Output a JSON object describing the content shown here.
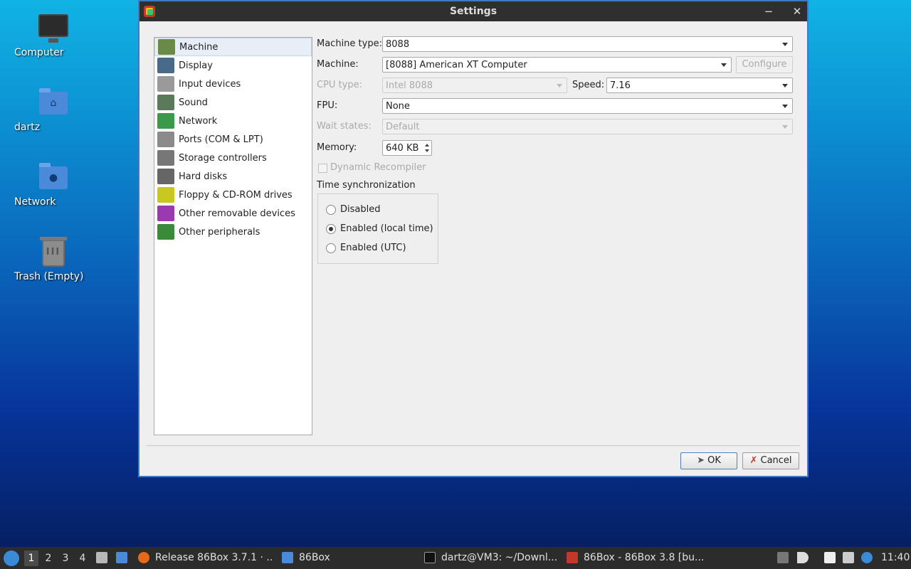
{
  "desktop": {
    "icons": [
      {
        "label": "Computer"
      },
      {
        "label": "dartz"
      },
      {
        "label": "Network"
      },
      {
        "label": "Trash (Empty)"
      }
    ]
  },
  "window": {
    "title": "Settings",
    "minimize_glyph": "−",
    "close_glyph": "✕"
  },
  "nav": {
    "items": [
      {
        "label": "Machine",
        "icon": "machine-icon"
      },
      {
        "label": "Display",
        "icon": "display-icon"
      },
      {
        "label": "Input devices",
        "icon": "input-devices-icon"
      },
      {
        "label": "Sound",
        "icon": "sound-icon"
      },
      {
        "label": "Network",
        "icon": "network-icon"
      },
      {
        "label": "Ports (COM & LPT)",
        "icon": "ports-icon"
      },
      {
        "label": "Storage controllers",
        "icon": "storage-icon"
      },
      {
        "label": "Hard disks",
        "icon": "hard-disk-icon"
      },
      {
        "label": "Floppy & CD-ROM drives",
        "icon": "floppy-cdrom-icon"
      },
      {
        "label": "Other removable devices",
        "icon": "removable-icon"
      },
      {
        "label": "Other peripherals",
        "icon": "peripherals-icon"
      }
    ],
    "selected": "Machine"
  },
  "form": {
    "machine_type": {
      "label": "Machine type:",
      "value": "8088"
    },
    "machine": {
      "label": "Machine:",
      "value": "[8088] American XT Computer",
      "configure": "Configure"
    },
    "cpu_type": {
      "label": "CPU type:",
      "value": "Intel 8088"
    },
    "speed": {
      "label": "Speed:",
      "value": "7.16"
    },
    "fpu": {
      "label": "FPU:",
      "value": "None"
    },
    "wait_states": {
      "label": "Wait states:",
      "value": "Default"
    },
    "memory": {
      "label": "Memory:",
      "value": "640 KB"
    },
    "dynamic_recompiler": {
      "label": "Dynamic Recompiler",
      "checked": false
    },
    "time_sync": {
      "label": "Time synchronization",
      "options": [
        "Disabled",
        "Enabled (local time)",
        "Enabled (UTC)"
      ],
      "selected": "Enabled (local time)"
    }
  },
  "buttons": {
    "ok": "OK",
    "cancel": "Cancel"
  },
  "taskbar": {
    "workspaces": [
      "1",
      "2",
      "3",
      "4"
    ],
    "active_workspace": "1",
    "tasks": [
      {
        "label": "Release 86Box 3.7.1 · ...",
        "icon": "firefox-icon"
      },
      {
        "label": "86Box",
        "icon": "folder-icon"
      },
      {
        "label": "dartz@VM3: ~/Downl...",
        "icon": "terminal-icon"
      },
      {
        "label": "86Box - 86Box 3.8 [bu...",
        "icon": "86box-icon"
      }
    ],
    "clock": "11:40"
  },
  "colors": {
    "accent": "#3e7bc2",
    "titlebar": "#2f2f2f",
    "taskbar": "#2c2c2c"
  }
}
